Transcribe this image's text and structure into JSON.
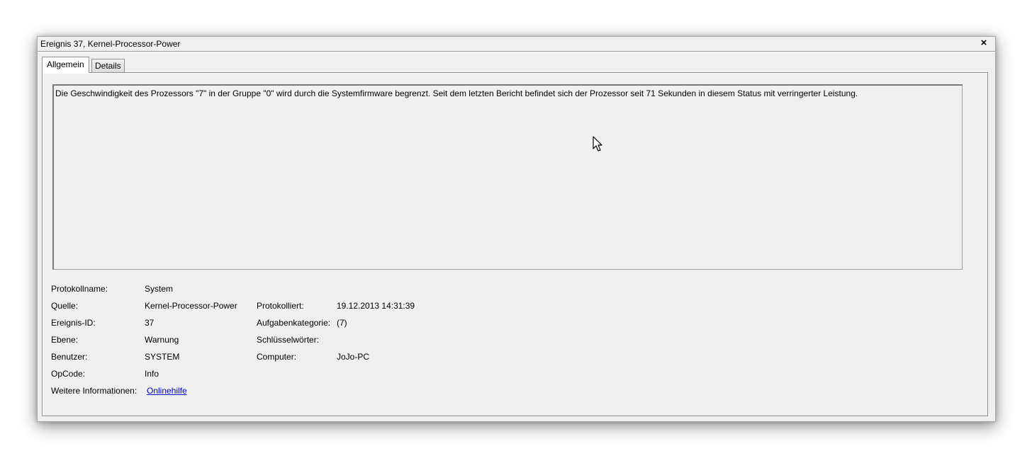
{
  "window": {
    "title": "Ereignis 37, Kernel-Processor-Power",
    "close_symbol": "×"
  },
  "tabs": [
    {
      "label": "Allgemein",
      "active": true
    },
    {
      "label": "Details",
      "active": false
    }
  ],
  "message": "Die Geschwindigkeit des Prozessors \"7\" in der Gruppe \"0\" wird durch die Systemfirmware begrenzt. Seit dem letzten Bericht befindet sich der Prozessor seit 71 Sekunden in diesem Status mit verringerter Leistung.",
  "properties": {
    "log_name": {
      "label": "Protokollname:",
      "value": "System"
    },
    "source": {
      "label": "Quelle:",
      "value": "Kernel-Processor-Power"
    },
    "logged": {
      "label": "Protokolliert:",
      "value": "19.12.2013 14:31:39"
    },
    "event_id": {
      "label": "Ereignis-ID:",
      "value": "37"
    },
    "task_category": {
      "label": "Aufgabenkategorie:",
      "value": "(7)"
    },
    "level": {
      "label": "Ebene:",
      "value": "Warnung"
    },
    "keywords": {
      "label": "Schlüsselwörter:",
      "value": ""
    },
    "user": {
      "label": "Benutzer:",
      "value": "SYSTEM"
    },
    "computer": {
      "label": "Computer:",
      "value": "JoJo-PC"
    },
    "opcode": {
      "label": "OpCode:",
      "value": "Info"
    },
    "more_info": {
      "label": "Weitere Informationen:",
      "link": "Onlinehilfe"
    }
  },
  "icons": {
    "close": "close-icon",
    "cursor": "mouse-pointer-icon"
  }
}
